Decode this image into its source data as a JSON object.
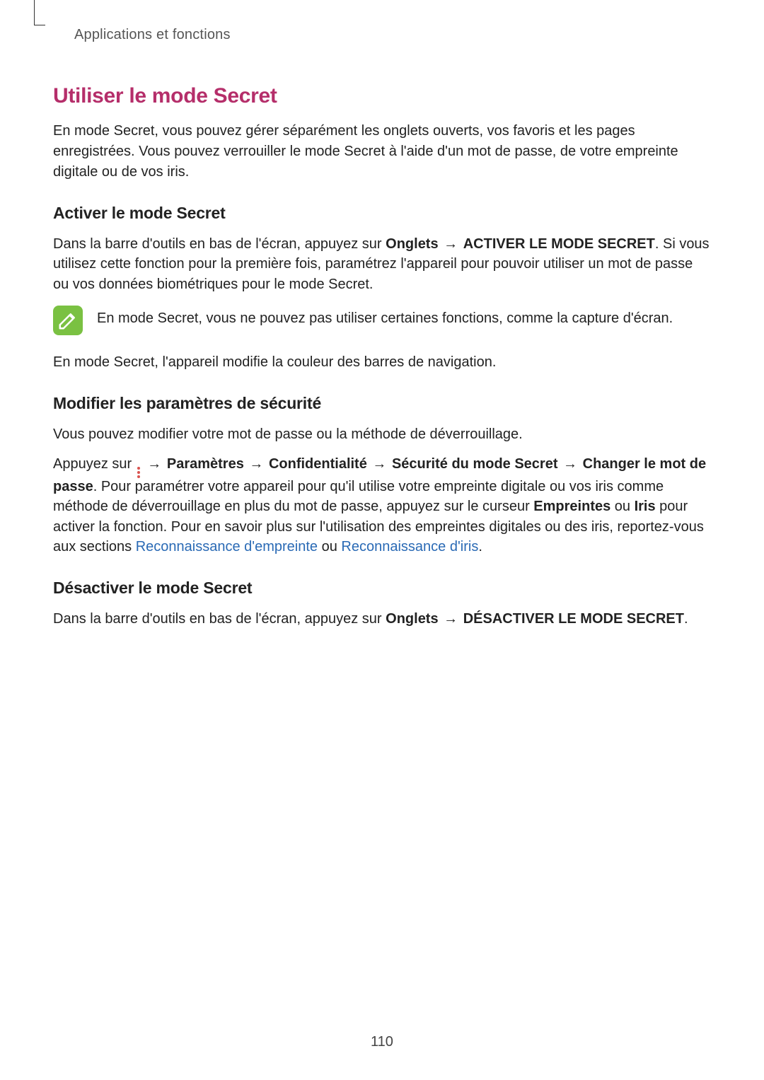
{
  "header": {
    "section_label": "Applications et fonctions"
  },
  "main": {
    "title": "Utiliser le mode Secret",
    "intro": "En mode Secret, vous pouvez gérer séparément les onglets ouverts, vos favoris et les pages enregistrées. Vous pouvez verrouiller le mode Secret à l'aide d'un mot de passe, de votre empreinte digitale ou de vos iris."
  },
  "s1": {
    "title": "Activer le mode Secret",
    "p1_pre": "Dans la barre d'outils en bas de l'écran, appuyez sur ",
    "p1_b1": "Onglets",
    "p1_arrow": " → ",
    "p1_b2": "ACTIVER LE MODE SECRET",
    "p1_post": ". Si vous utilisez cette fonction pour la première fois, paramétrez l'appareil pour pouvoir utiliser un mot de passe ou vos données biométriques pour le mode Secret.",
    "note": "En mode Secret, vous ne pouvez pas utiliser certaines fonctions, comme la capture d'écran.",
    "p2": "En mode Secret, l'appareil modifie la couleur des barres de navigation."
  },
  "s2": {
    "title": "Modifier les paramètres de sécurité",
    "p1": "Vous pouvez modifier votre mot de passe ou la méthode de déverrouillage.",
    "p2_pre": "Appuyez sur ",
    "arrow": " → ",
    "b1": "Paramètres",
    "b2": "Confidentialité",
    "b3": "Sécurité du mode Secret",
    "b4": "Changer le mot de passe",
    "p2_mid1": ". Pour paramétrer votre appareil pour qu'il utilise votre empreinte digitale ou vos iris comme méthode de déverrouillage en plus du mot de passe, appuyez sur le curseur ",
    "b5": "Empreintes",
    "p2_mid2": " ou ",
    "b6": "Iris",
    "p2_mid3": " pour activer la fonction. Pour en savoir plus sur l'utilisation des empreintes digitales ou des iris, reportez-vous aux sections ",
    "link1": "Reconnaissance d'empreinte",
    "p2_mid4": " ou ",
    "link2": "Reconnaissance d'iris",
    "p2_end": "."
  },
  "s3": {
    "title": "Désactiver le mode Secret",
    "p1_pre": "Dans la barre d'outils en bas de l'écran, appuyez sur ",
    "p1_b1": "Onglets",
    "p1_arrow": " → ",
    "p1_b2": "DÉSACTIVER LE MODE SECRET",
    "p1_end": "."
  },
  "page_number": "110"
}
